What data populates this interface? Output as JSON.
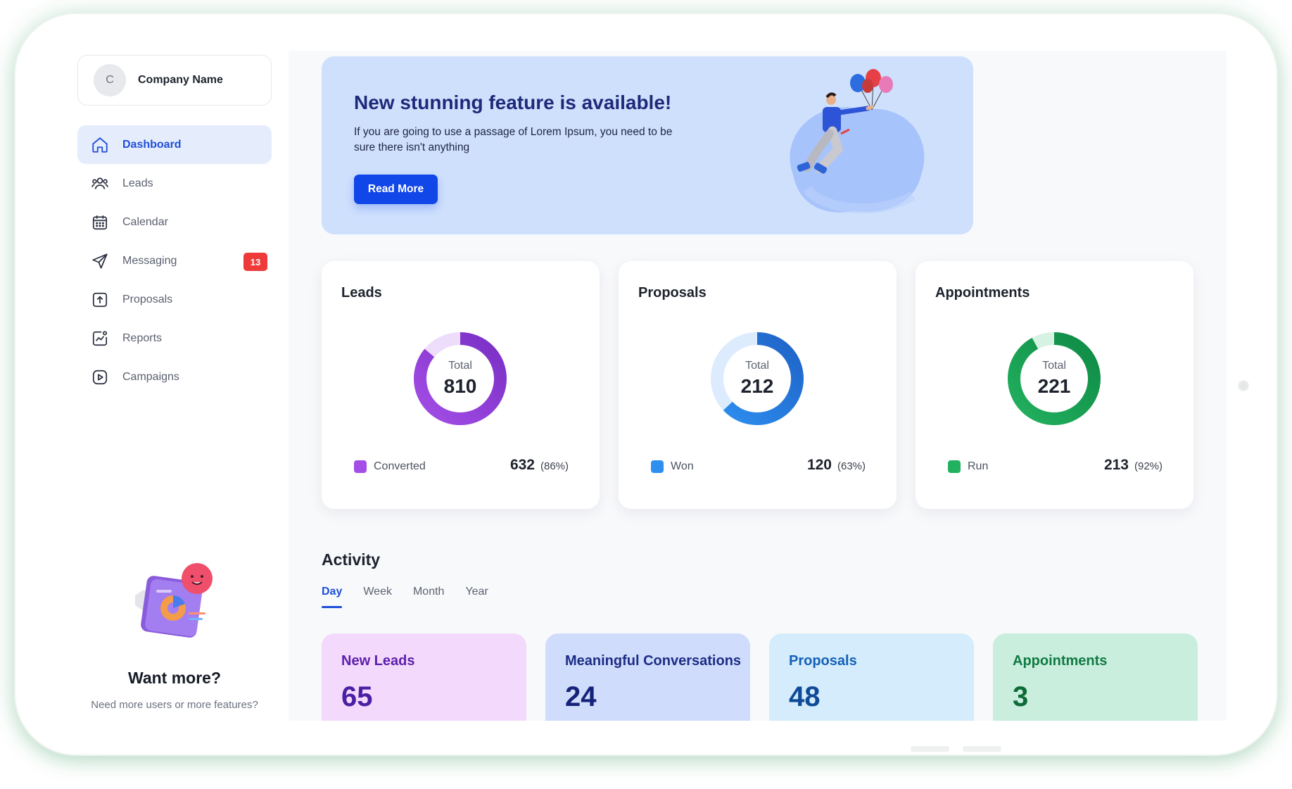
{
  "company": {
    "avatar_initial": "C",
    "name": "Company Name"
  },
  "sidebar": {
    "items": [
      {
        "label": "Dashboard",
        "icon": "home-icon",
        "active": true
      },
      {
        "label": "Leads",
        "icon": "users-icon"
      },
      {
        "label": "Calendar",
        "icon": "calendar-icon"
      },
      {
        "label": "Messaging",
        "icon": "send-icon",
        "badge": "13"
      },
      {
        "label": "Proposals",
        "icon": "upload-icon"
      },
      {
        "label": "Reports",
        "icon": "chart-icon"
      },
      {
        "label": "Campaigns",
        "icon": "play-icon"
      }
    ],
    "promo": {
      "title": "Want more?",
      "text": "Need more users or more features?"
    }
  },
  "banner": {
    "title": "New stunning feature is available!",
    "text": "If you are going to use a passage of Lorem Ipsum, you need to be sure there isn't anything",
    "button": "Read More"
  },
  "stats": [
    {
      "title": "Leads",
      "caption": "Total",
      "total": "810",
      "legend_label": "Converted",
      "legend_value": "632",
      "legend_pct": "(86%)",
      "fraction": 0.86,
      "color": "#a34ee6",
      "color_dark": "#7a2fc4",
      "track": "#eddcfa"
    },
    {
      "title": "Proposals",
      "caption": "Total",
      "total": "212",
      "legend_label": "Won",
      "legend_value": "120",
      "legend_pct": "(63%)",
      "fraction": 0.63,
      "color": "#2d8ff0",
      "color_dark": "#1f63c7",
      "track": "#dcebfd"
    },
    {
      "title": "Appointments",
      "caption": "Total",
      "total": "221",
      "legend_label": "Run",
      "legend_value": "213",
      "legend_pct": "(92%)",
      "fraction": 0.92,
      "color": "#22b15f",
      "color_dark": "#0f8a45",
      "track": "#d5f2e2"
    }
  ],
  "activity": {
    "title": "Activity",
    "tabs": [
      "Day",
      "Week",
      "Month",
      "Year"
    ],
    "active_tab": "Day",
    "cards": [
      {
        "label": "New Leads",
        "value": "65",
        "bg": "#f3d9fb",
        "fg": "#5b1fae",
        "num": "#4a1fa3"
      },
      {
        "label": "Meaningful Conversations",
        "value": "24",
        "bg": "#cfdcfb",
        "fg": "#1c2d86",
        "num": "#15227a"
      },
      {
        "label": "Proposals",
        "value": "48",
        "bg": "#d4ecfb",
        "fg": "#1460b8",
        "num": "#0f4a98"
      },
      {
        "label": "Appointments",
        "value": "3",
        "bg": "#c9eedd",
        "fg": "#117a43",
        "num": "#0d6a39"
      }
    ]
  }
}
